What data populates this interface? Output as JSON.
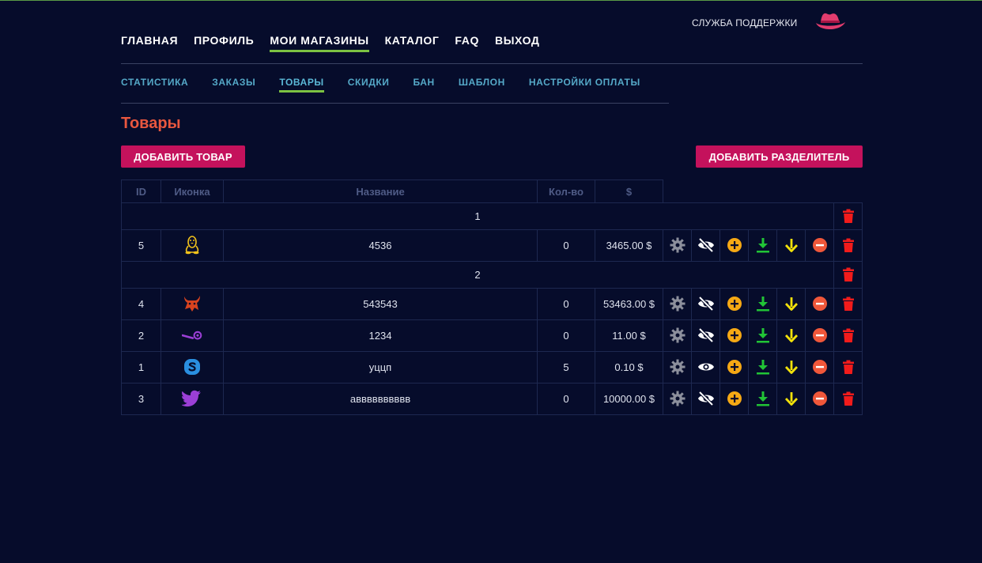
{
  "header": {
    "support_label": "СЛУЖБА ПОДДЕРЖКИ",
    "main_nav": [
      "ГЛАВНАЯ",
      "ПРОФИЛЬ",
      "МОИ МАГАЗИНЫ",
      "КАТАЛОГ",
      "FAQ",
      "ВЫХОД"
    ],
    "main_nav_active": "МОИ МАГАЗИНЫ",
    "sub_nav": [
      "СТАТИСТИКА",
      "ЗАКАЗЫ",
      "ТОВАРЫ",
      "СКИДКИ",
      "БАН",
      "ШАБЛОН",
      "НАСТРОЙКИ ОПЛАТЫ"
    ],
    "sub_nav_active": "ТОВАРЫ"
  },
  "page": {
    "title": "Товары",
    "add_product_label": "ДОБАВИТЬ ТОВАР",
    "add_separator_label": "ДОБАВИТЬ РАЗДЕЛИТЕЛЬ"
  },
  "table": {
    "columns": [
      "ID",
      "Иконка",
      "Название",
      "Кол-во",
      "$"
    ],
    "rows": [
      {
        "type": "separator",
        "label": "1"
      },
      {
        "type": "item",
        "id": "5",
        "icon": "linux-icon",
        "name": "4536",
        "qty": "0",
        "price": "3465.00 $",
        "visible": false
      },
      {
        "type": "separator",
        "label": "2"
      },
      {
        "type": "item",
        "id": "4",
        "icon": "bull-icon",
        "name": "543543",
        "qty": "0",
        "price": "53463.00 $",
        "visible": false
      },
      {
        "type": "item",
        "id": "2",
        "icon": "steam-icon",
        "name": "1234",
        "qty": "0",
        "price": "11.00 $",
        "visible": false
      },
      {
        "type": "item",
        "id": "1",
        "icon": "skype-icon",
        "name": "уццп",
        "qty": "5",
        "price": "0.10 $",
        "visible": true
      },
      {
        "type": "item",
        "id": "3",
        "icon": "twitter-icon",
        "name": "авввввввввв",
        "qty": "0",
        "price": "10000.00 $",
        "visible": false
      }
    ]
  },
  "colors": {
    "background": "#060c2b",
    "accent_button": "#c4125c",
    "title": "#e9573f",
    "nav_underline": "#7cc242",
    "subnav": "#55a9c8"
  }
}
